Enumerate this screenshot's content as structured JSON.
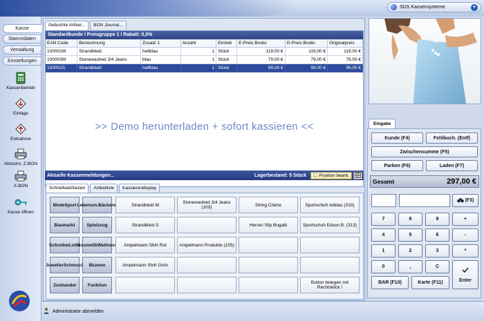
{
  "app": {
    "menu_label": "SDS Kassensysteme"
  },
  "nav": {
    "tabs": [
      "Kasse",
      "Stammdaten",
      "Verwaltung",
      "Einstellungen"
    ],
    "tools": [
      "Kassenbetrieb",
      "Einlage",
      "Entnahme",
      "Abrechn. Z-BON",
      "X-BON",
      "Kasse öffnen"
    ]
  },
  "main": {
    "tabs": [
      "Gebuchte Artikel...",
      "BON Journal..."
    ],
    "customer_header": "Standardkunde / Preisgruppe 1 / Rabatt: 0,0%",
    "columns": [
      "EAN Code",
      "Bezeichnung",
      "Zusatz 1",
      "Anzahl",
      "Einheit",
      "E-Preis Brutto",
      "G-Preis Brutto",
      "Originalpreis"
    ],
    "rows": [
      [
        "100001M",
        "Strandkleid",
        "hellblau",
        "1",
        "Stück",
        "119,00 €",
        "119,00 €",
        "119,00 €"
      ],
      [
        "100003M",
        "Stonewashed 3/4 Jeans",
        "blau",
        "1",
        "Stück",
        "79,00 €",
        "79,00 €",
        "79,00 €"
      ],
      [
        "100001S",
        "Strandkleid",
        "hellblau",
        "1",
        "Stück",
        "99,00 €",
        "99,00 €",
        "99,00 €"
      ]
    ],
    "demo_text": ">> Demo herunterladen + sofort kassieren <<",
    "messages_label": "Aktuelle Kassenmeldungen...",
    "stock_label": "Lagerbestand: 5 Stück",
    "position_button": "Position bearb."
  },
  "quick": {
    "tabs": [
      "Schnellwahltasten",
      "Artikelliste",
      "Kassierendisplay"
    ],
    "categories": [
      [
        "Mode",
        "Sport"
      ],
      [
        "Lebensm.",
        "Bäckerei"
      ],
      [
        "Baumarkt"
      ],
      [
        "Spielzeug"
      ],
      [
        "Schreibw",
        "Lotto"
      ],
      [
        "Kosmetik",
        "Wellness"
      ],
      [
        "Juwelier",
        "Schmuck"
      ],
      [
        "Blumen"
      ],
      [
        "Zoo",
        "handel"
      ],
      [
        "Funktion"
      ]
    ],
    "products": [
      [
        "Strandkleid M",
        "Stonewashed 3/4 Jeans (103)",
        "String Chérie",
        "Sportschuh Adidas (310)"
      ],
      [
        "Strandkleid S",
        "",
        "Herren Slip Bugatti",
        "Sportschuh Edson B. (313)"
      ],
      [
        "Ampelmann Shirt Rot",
        "Ampelmann Produkte (105)",
        "",
        ""
      ],
      [
        "Ampelmann Shirt Grün",
        "",
        "",
        ""
      ],
      [
        "",
        "",
        "",
        "Button belegen mit Rechtsklick !"
      ]
    ]
  },
  "input": {
    "header": "Eingabe",
    "kunde": "Kunde (F4)",
    "fehlbuch": "Fehlbuch. (Entf)",
    "zwischensumme": "Zwischensumme (F5)",
    "parken": "Parken (F6)",
    "laden": "Laden (F7)",
    "total_label": "Gesamt",
    "total_value": "297,00 €",
    "search_key": "(F3)",
    "keypad": [
      "7",
      "8",
      "9",
      "+",
      "4",
      "5",
      "6",
      "-",
      "1",
      "2",
      "3",
      "*",
      "0",
      ",",
      "C"
    ],
    "enter": "Enter",
    "bar": "BAR (F10)",
    "karte": "Karte (F11)"
  },
  "status": {
    "logout": "Administrator abmelden"
  },
  "colors": {
    "accent": "#2d4b9c",
    "header_bar": "#2c4487",
    "demo_text": "#6d85c9"
  }
}
